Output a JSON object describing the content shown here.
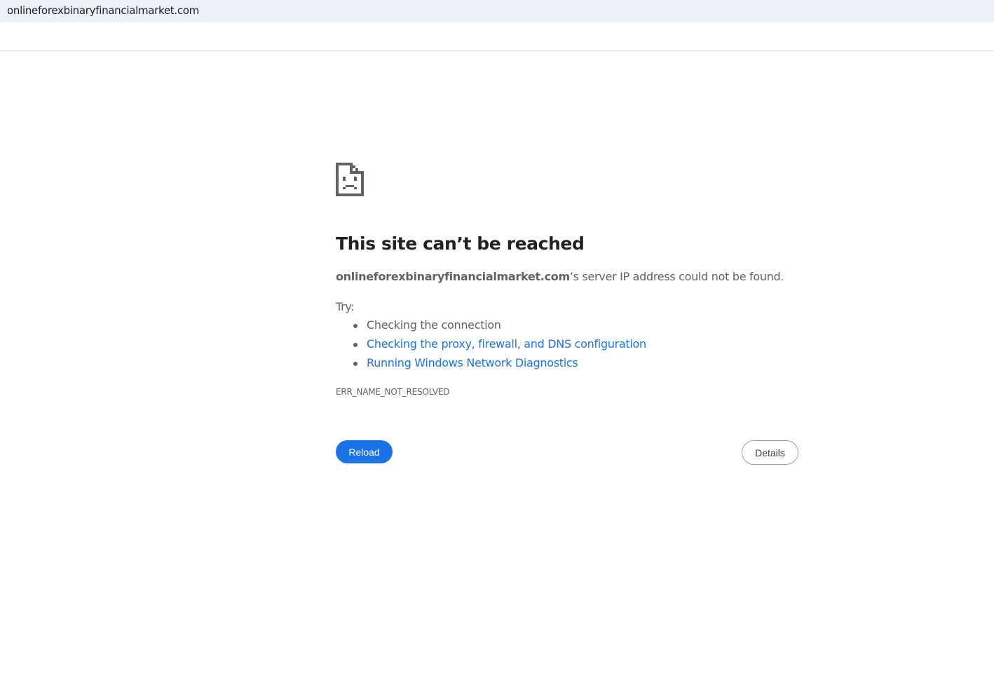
{
  "browser": {
    "address": "onlineforexbinaryfinancialmarket.com"
  },
  "error": {
    "icon": "sad-page-icon",
    "title": "This site can’t be reached",
    "host": "onlineforexbinaryfinancialmarket.com",
    "message_suffix": "’s server IP address could not be found.",
    "try_label": "Try:",
    "suggestions": [
      {
        "label": "Checking the connection",
        "link": false
      },
      {
        "label": "Checking the proxy, firewall, and DNS configuration",
        "link": true
      },
      {
        "label": "Running Windows Network Diagnostics",
        "link": true
      }
    ],
    "code": "ERR_NAME_NOT_RESOLVED"
  },
  "buttons": {
    "reload_label": "Reload",
    "details_label": "Details"
  },
  "colors": {
    "accent": "#1a73e8",
    "text": "#5f6368",
    "title": "#202124",
    "address_bar_bg": "#edf1f9"
  }
}
